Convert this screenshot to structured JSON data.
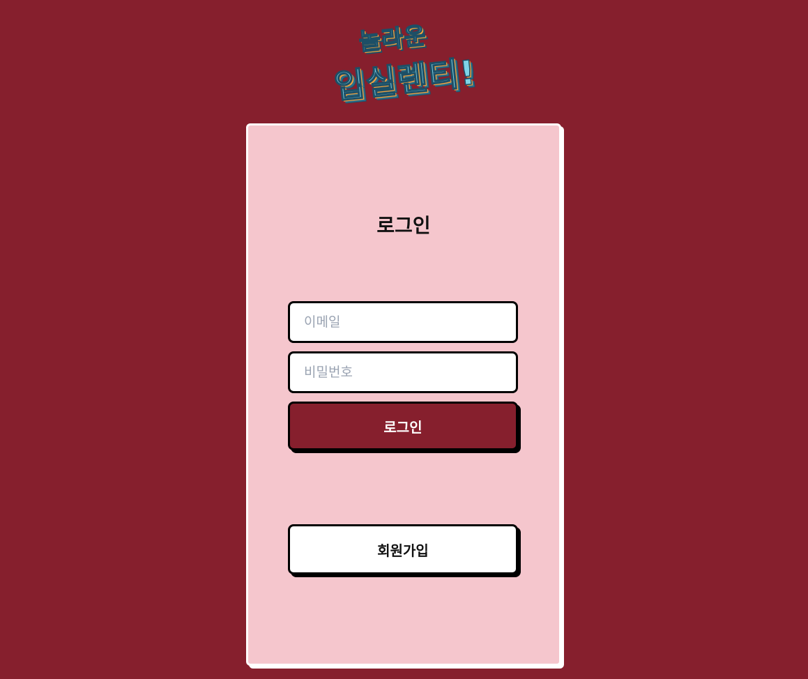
{
  "logo": {
    "line1": "놀라운",
    "line2": "입실렌티!"
  },
  "login_card": {
    "title": "로그인",
    "email_placeholder": "이메일",
    "password_placeholder": "비밀번호",
    "login_button_label": "로그인",
    "signup_button_label": "회원가입"
  },
  "colors": {
    "background": "#861f2d",
    "card": "#f5c6cd",
    "login_button": "#861f2d",
    "logo_main": "#7fd4e8",
    "logo_accent": "#f4a23c"
  }
}
